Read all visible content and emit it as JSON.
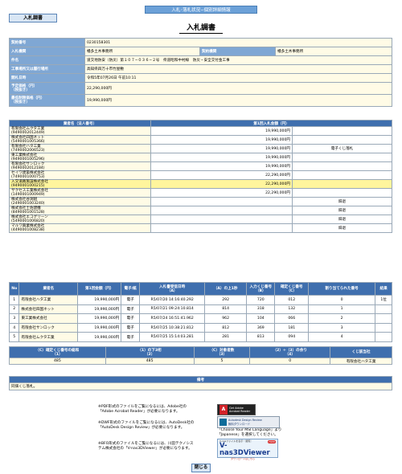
{
  "header": {
    "topbar": "入札･落札状況−個別詳細情報",
    "tab_label": "入札調書",
    "page_title": "入札調書"
  },
  "info": {
    "keiyaku_no_label": "契約番号",
    "keiyaku_no": "0230158301",
    "nyusatsu_kikan_label": "入札機関",
    "nyusatsu_kikan": "幡多土木事務所",
    "keiyaku_kikan_label": "契約機関",
    "keiyaku_kikan": "幡多土木事務所",
    "kenmei_label": "件名",
    "kenmei": "道交地防安（防災）第１０７−０３６−２号　県道昭和中村線　防災・安全交付金工事",
    "basho_label": "工事場所又は履行場所",
    "basho": "高知県四万十市竹屋敷",
    "kaisatsu_label": "開札日時",
    "kaisatsu": "令和5年07月26日 午前10:11",
    "yotei_label": "予定価格（円）\n（税抜き）",
    "yotei": "22,290,000円",
    "saitei_label": "最低制限価格（円）\n（税抜き）",
    "saitei": "19,990,000円"
  },
  "bids": {
    "col_name": "業者名（法人番号）",
    "col_amount": "第1回入札金額（円）",
    "rows": [
      {
        "name": "有限会社ムクタ工業",
        "num": "(9490002012449)",
        "amount": "19,990,000円",
        "note": ""
      },
      {
        "name": "株式会社四国ネット",
        "num": "(5490001005366)",
        "amount": "19,990,000円",
        "note": ""
      },
      {
        "name": "有限会社ハタ工業",
        "num": "(7490002006523)",
        "amount": "19,990,000円",
        "note": "電子くじ落札"
      },
      {
        "name": "東工業株式会社",
        "num": "(9490001005296)",
        "amount": "19,990,000円",
        "note": ""
      },
      {
        "name": "有限会社サンロック",
        "num": "(9490002012184)",
        "amount": "19,990,000円",
        "note": ""
      },
      {
        "name": "セイワ建築株式会社",
        "num": "(7490001000753)",
        "amount": "22,290,000円",
        "note": ""
      },
      {
        "name": "入交道路施設株式会社",
        "num": "(9490001000215)",
        "amount": "22,290,000円",
        "note": ""
      },
      {
        "name": "サクセス工業株式会社",
        "num": "(1490001000949)",
        "amount": "22,290,000円",
        "note": ""
      },
      {
        "name": "株式会社谷渕組",
        "num": "(2490001003240)",
        "amount": "",
        "note": "辞退"
      },
      {
        "name": "株式会社土佐建機",
        "num": "(8490001001528)",
        "amount": "",
        "note": "辞退"
      },
      {
        "name": "株式会社エコグリーン",
        "num": "(5490001006820)",
        "amount": "",
        "note": "辞退"
      },
      {
        "name": "マルワ興業株式会社",
        "num": "(4490001008238)",
        "amount": "",
        "note": "辞退"
      }
    ]
  },
  "lottery": {
    "headers": [
      "No",
      "業者名",
      "第1回金額（円）",
      "電子/紙",
      "入札書受信日時\n（A）",
      "（A）の上1秒",
      "入力くじ番号\n（B）",
      "確定くじ番号\n（C）",
      "割り当てられた番号",
      "結果"
    ],
    "rows": [
      [
        "1",
        "有限会社ハタ工業",
        "19,990,000円",
        "電子",
        "R5/07/20 14:16:40.292",
        "292",
        "720",
        "012",
        "0",
        "1位"
      ],
      [
        "2",
        "株式会社四国ネット",
        "19,990,000円",
        "電子",
        "R5/07/21 09:24:10.814",
        "814",
        "318",
        "132",
        "1",
        ""
      ],
      [
        "3",
        "東工業株式会社",
        "19,990,000円",
        "電子",
        "R5/07/24 16:51:41.962",
        "962",
        "104",
        "066",
        "2",
        ""
      ],
      [
        "4",
        "有限会社サンロック",
        "19,990,000円",
        "電子",
        "R5/07/25 10:38:21.812",
        "812",
        "369",
        "181",
        "3",
        ""
      ],
      [
        "5",
        "有限会社ムクタ工業",
        "19,990,000円",
        "電子",
        "R5/07/25 15:14:03.281",
        "281",
        "813",
        "094",
        "4",
        ""
      ]
    ],
    "sum_headers": [
      "（C）確定くじ番号の総和\n（1）",
      "（1）の下3桁\n（2）",
      "（C）対象者数\n（3）",
      "（2）÷（3）の余り\n（4）",
      "くじ該当社"
    ],
    "sum_values": [
      "485",
      "485",
      "5",
      "0",
      "有限会社ハタ工業"
    ]
  },
  "remarks": {
    "label": "備考",
    "text": "同価くじ落札。"
  },
  "notes": {
    "pdf": "※PDF形式のファイルをご覧になるには、Adobe社の\n「Adobe Acrobat Reader」が必要になります。",
    "dwf": "※DWF形式のファイルをご覧になるには、AutoDesk社の\n「AutoDesk Design Review」が必要になります。",
    "dwf_right": "「Choose Your MSI Language」より\n「Japanese」を選択してください。",
    "bfo": "※BFO形式のファイルをご覧になるには、川田テクノシス\nテム株式会社の「V-nas3DViewer」が必要になります。"
  },
  "badges": {
    "adobe": "Get Adobe\nAcrobat Reader",
    "autodesk": "Autodesk Design Review\n無料ダウンロード",
    "vnas_top": "V-nasファイルを表示・閲覧！",
    "vnas": "V-nas3DViewer",
    "vnas_sub": "ダウンロードはこちら",
    "free": "FREE"
  },
  "footer": {
    "close": "閉じる"
  },
  "colors": {
    "header_blue": "#3f6fae",
    "label_blue": "#7fa7d4",
    "cream": "#fffbe6",
    "highlight": "#fff59d"
  }
}
